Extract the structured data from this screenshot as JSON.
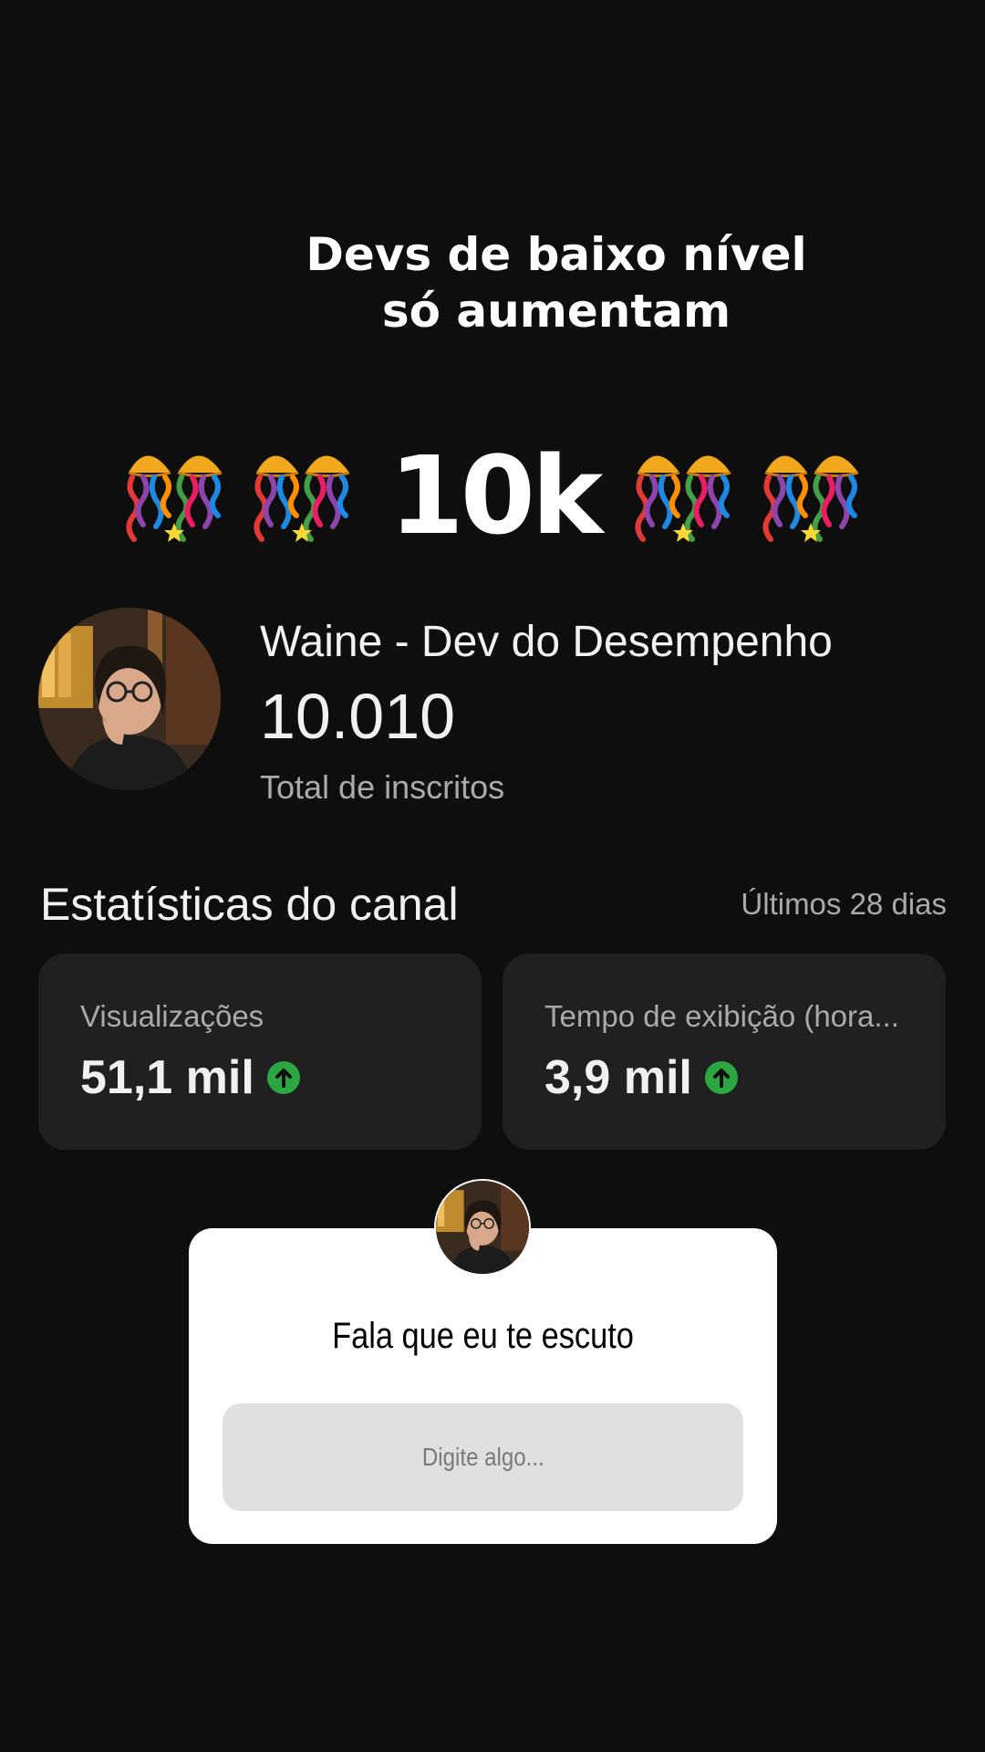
{
  "story": {
    "caption": "Devs de baixo nível só aumentam"
  },
  "milestone": {
    "text": "10k",
    "emoji_icon": "confetti-jellyfish-icon"
  },
  "channel": {
    "name": "Waine - Dev do Desempenho",
    "subscriber_count": "10.010",
    "subscriber_label": "Total de inscritos"
  },
  "stats": {
    "title": "Estatísticas do canal",
    "period": "Últimos 28 dias",
    "cards": [
      {
        "label": "Visualizações",
        "value": "51,1 mil",
        "trend": "up"
      },
      {
        "label": "Tempo de exibição (hora...",
        "value": "3,9 mil",
        "trend": "up"
      }
    ]
  },
  "question_sticker": {
    "prompt": "Fala que eu te escuto",
    "placeholder": "Digite algo..."
  },
  "colors": {
    "background": "#0e0e0e",
    "card": "#202020",
    "trend_up": "#2ba640"
  }
}
